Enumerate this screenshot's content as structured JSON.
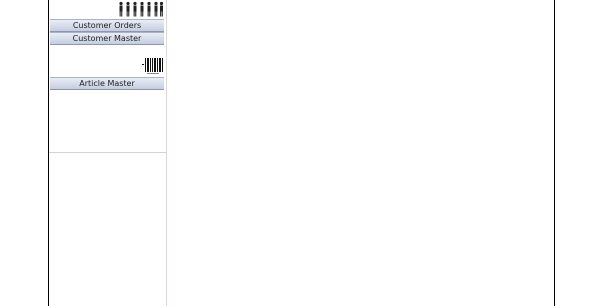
{
  "sidebar": {
    "customers_section": {
      "icon": "people-icon",
      "buttons": [
        {
          "label": "Customer Orders"
        },
        {
          "label": "Customer Master"
        }
      ]
    },
    "articles_section": {
      "icon": "barcode-icon",
      "buttons": [
        {
          "label": "Article Master"
        }
      ]
    }
  },
  "colors": {
    "button_gradient_top": "#e9edf5",
    "button_gradient_bottom": "#c4cde0",
    "frame_border": "#000000"
  }
}
